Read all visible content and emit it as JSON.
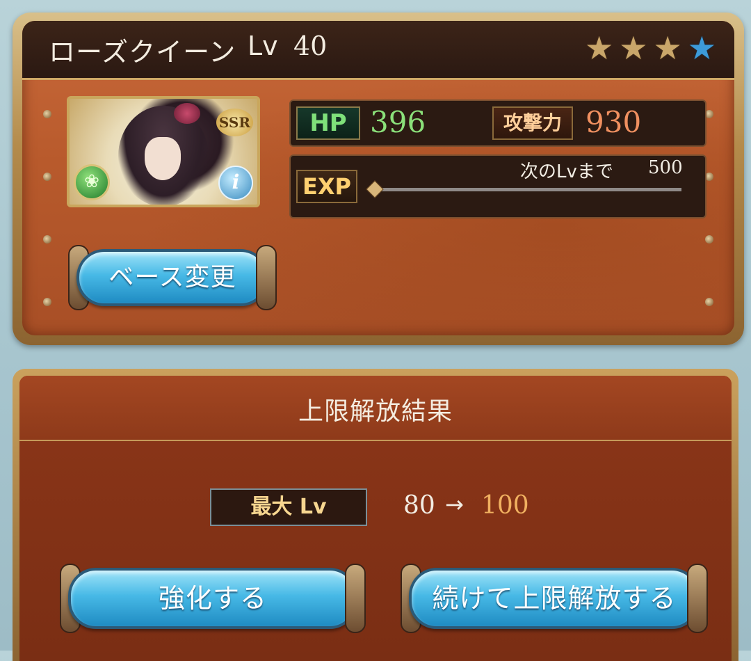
{
  "character": {
    "name": "ローズクイーン",
    "lv_label": "Lv",
    "level": "40",
    "rarity": "SSR",
    "stars": [
      {
        "type": "gold",
        "glyph": "★"
      },
      {
        "type": "gold",
        "glyph": "★"
      },
      {
        "type": "gold",
        "glyph": "★"
      },
      {
        "type": "blue",
        "glyph": "★"
      }
    ]
  },
  "stats": {
    "hp_label": "HP",
    "hp_value": "396",
    "atk_label": "攻撃力",
    "atk_value": "930",
    "exp_label": "EXP",
    "next_label": "次のLvまで",
    "next_value": "500",
    "exp_progress_fraction": 0.0
  },
  "buttons": {
    "base_change": "ベース変更",
    "enhance": "強化する",
    "continue_uncap": "続けて上限解放する"
  },
  "result": {
    "title": "上限解放結果",
    "max_lv_label": "最大 Lv",
    "from": "80",
    "arrow": "→",
    "to": "100"
  },
  "icons": {
    "element": "wind-element-icon",
    "info": "info-icon"
  }
}
